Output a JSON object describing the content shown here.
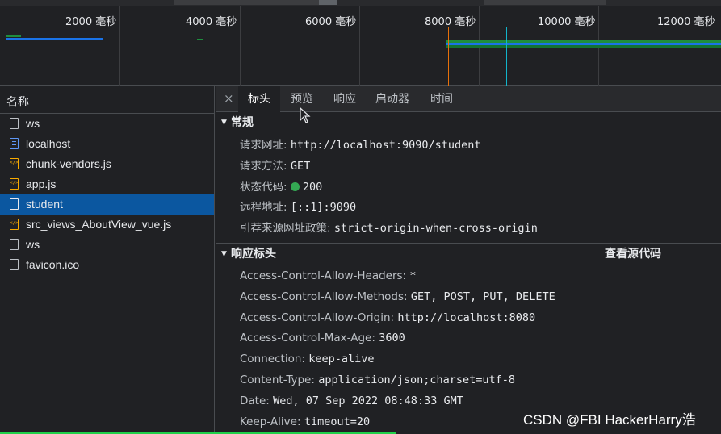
{
  "timeline": {
    "ticks": [
      "2000 毫秒",
      "4000 毫秒",
      "6000 毫秒",
      "8000 毫秒",
      "10000 毫秒",
      "12000 毫秒"
    ]
  },
  "list": {
    "header": "名称",
    "items": [
      {
        "name": "ws",
        "icon": "file-icon"
      },
      {
        "name": "localhost",
        "icon": "document-icon"
      },
      {
        "name": "chunk-vendors.js",
        "icon": "script-icon"
      },
      {
        "name": "app.js",
        "icon": "script-icon"
      },
      {
        "name": "student",
        "icon": "file-icon"
      },
      {
        "name": "src_views_AboutView_vue.js",
        "icon": "script-icon"
      },
      {
        "name": "ws",
        "icon": "file-icon"
      },
      {
        "name": "favicon.ico",
        "icon": "file-icon"
      }
    ],
    "selected_index": 4
  },
  "tabs": {
    "close": "×",
    "items": [
      "标头",
      "预览",
      "响应",
      "启动器",
      "时间"
    ],
    "active_index": 0
  },
  "general": {
    "title": "常规",
    "request_url": {
      "key": "请求网址:",
      "value": "http://localhost:9090/student"
    },
    "request_method": {
      "key": "请求方法:",
      "value": "GET"
    },
    "status_code": {
      "key": "状态代码:",
      "value": "200"
    },
    "remote_address": {
      "key": "远程地址:",
      "value": "[::1]:9090"
    },
    "referrer_policy": {
      "key": "引荐来源网址政策:",
      "value": "strict-origin-when-cross-origin"
    }
  },
  "response_headers": {
    "title": "响应标头",
    "view_source": "查看源代码",
    "items": [
      {
        "key": "Access-Control-Allow-Headers:",
        "value": "*"
      },
      {
        "key": "Access-Control-Allow-Methods:",
        "value": "GET, POST, PUT, DELETE"
      },
      {
        "key": "Access-Control-Allow-Origin:",
        "value": "http://localhost:8080"
      },
      {
        "key": "Access-Control-Max-Age:",
        "value": "3600"
      },
      {
        "key": "Connection:",
        "value": "keep-alive"
      },
      {
        "key": "Content-Type:",
        "value": "application/json;charset=utf-8"
      },
      {
        "key": "Date:",
        "value": "Wed, 07 Sep 2022 08:48:33 GMT"
      },
      {
        "key": "Keep-Alive:",
        "value": "timeout=20"
      }
    ]
  },
  "watermark": "CSDN @FBI HackerHarry浩",
  "colors": {
    "selected_row": "#0b57a0",
    "status_ok": "#34a853",
    "waterfall_green": "#1e8e3e",
    "waterfall_blue": "#1a73e8"
  }
}
